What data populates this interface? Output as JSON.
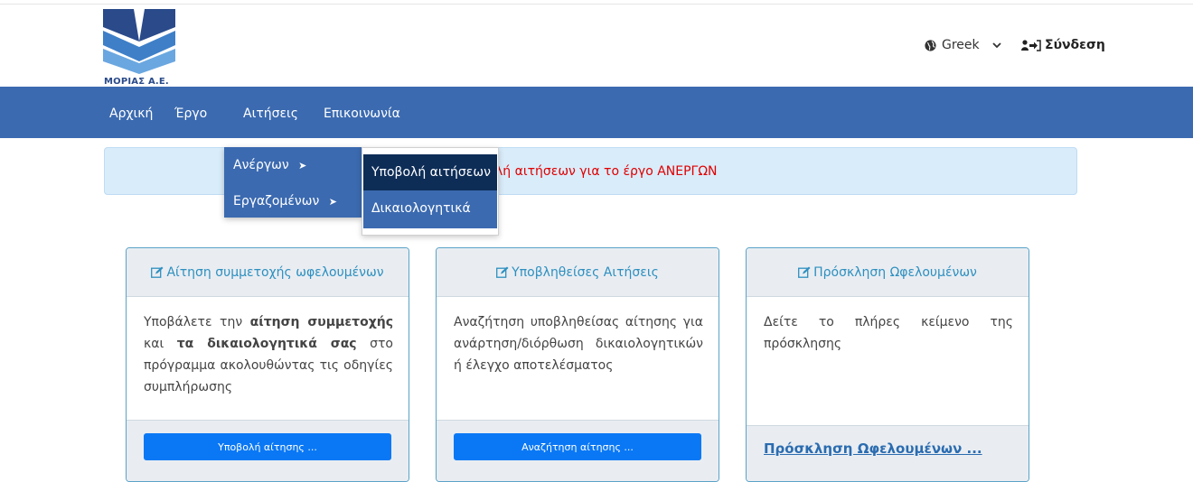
{
  "header": {
    "logo_text": "ΜΟΡΙΑΣ Α.Ε.",
    "language": "Greek",
    "login_label": "Σύνδεση"
  },
  "nav": {
    "items": [
      "Αρχική",
      "Έργο",
      "Αιτήσεις",
      "Επικοινωνία"
    ]
  },
  "alert": {
    "text": "λή αιτήσεων για το έργο  ΑΝΕΡΓΩΝ"
  },
  "dropdown": {
    "level1": [
      {
        "label": "Ανέργων",
        "arrow": "➤"
      },
      {
        "label": "Εργαζομένων",
        "arrow": "➤"
      }
    ],
    "level2": [
      "Υποβολή αιτήσεων",
      "Δικαιολογητικά"
    ]
  },
  "cards": [
    {
      "title": "Αίτηση συμμετοχής ωφελουμένων",
      "body_1": "Υποβάλετε την ",
      "body_bold_1": "αίτηση συμμετοχής",
      "body_2": " και ",
      "body_bold_2": "τα δικαιολογητικά σας",
      "body_3": " στο πρόγραμμα ακολουθώντας τις οδηγίες συμπλήρωσης",
      "button": "Υποβολή αίτησης ..."
    },
    {
      "title": "Υποβληθείσες Αιτήσεις",
      "body": "Αναζήτηση υποβληθείσας αίτησης για ανάρτηση/διόρθωση δικαιολογητικών ή έλεγχο αποτελέσματος",
      "button": "Αναζήτηση αίτησης ..."
    },
    {
      "title": "Πρόσκληση Ωφελουμένων",
      "body": "Δείτε το πλήρες κείμενο της πρόσκλησης",
      "link": "Πρόσκληση Ωφελουμένων ..."
    }
  ],
  "colors": {
    "navbar": "#3b6ab0",
    "alert_bg": "#d9ecfa",
    "alert_text": "#e00000",
    "button": "#0a78f5",
    "card_title": "#2d8fbf",
    "submenu_active": "#0d2d57"
  }
}
